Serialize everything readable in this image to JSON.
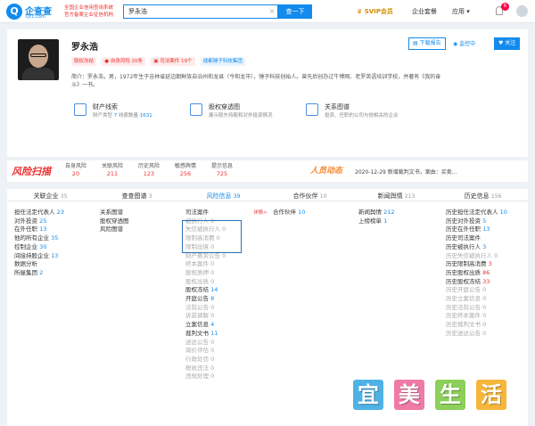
{
  "header": {
    "logo_glyph": "Q",
    "logo_name": "企查查",
    "logo_sub": "Qcc.com",
    "slogan_line1": "全国企业信用查询系统",
    "slogan_line2": "官方备案企业征信机构",
    "search_value": "罗永浩",
    "search_clear": "×",
    "search_button": "查一下",
    "svip": "SVIP会员",
    "nav_enterprise": "企业套餐",
    "nav_apps": "应用",
    "badge_count": "6",
    "brand_color": "#128bed"
  },
  "person": {
    "name": "罗永浩",
    "tags": [
      "股权冻结",
      "自身风险 20条",
      "司法案件 19个",
      "成都锤子科技集团"
    ],
    "bio": "简介：罗永浩，男，1972年生于吉林省延边朝鲜族自治州和龙县（今和龙市），锤子科技创始人。曾先后创办过牛博网、老罗英语培训学校，并著有《我的奋斗》一书。",
    "report_button": "下载报告",
    "monitor_button": "监控中",
    "follow_button": "关注"
  },
  "features": [
    {
      "title": "财产线索",
      "desc_prefix": "财产类型 ",
      "desc_a": "7",
      "desc_mid": " 线索数量 ",
      "desc_b": "1631"
    },
    {
      "title": "股权穿透图",
      "desc": "展示股东持股和对外投资情况"
    },
    {
      "title": "关系图谱",
      "desc": "投资、任职的公司与他相关的企业"
    }
  ],
  "risk": {
    "logo": "风险扫描",
    "cols": [
      {
        "label": "自身风险",
        "value": "20"
      },
      {
        "label": "关联风险",
        "value": "211"
      },
      {
        "label": "历史风险",
        "value": "123"
      },
      {
        "label": "敏感舆情",
        "value": "256"
      },
      {
        "label": "提示信息",
        "value": "725"
      }
    ],
    "news_logo": "人员动态",
    "news_text": "2020-12-29 新增裁判文书，案由：买卖..."
  },
  "tabs": [
    {
      "label": "关联企业",
      "count": "35"
    },
    {
      "label": "查查图谱",
      "count": "3"
    },
    {
      "label": "风险信息",
      "count": "39"
    },
    {
      "label": "合作伙伴",
      "count": "10"
    },
    {
      "label": "新闻舆情",
      "count": "213"
    },
    {
      "label": "历史信息",
      "count": "156"
    }
  ],
  "list": {
    "detail_link": "详情>",
    "col1": [
      {
        "t": "担任法定代表人",
        "n": "23"
      },
      {
        "t": "对外投资",
        "n": "25"
      },
      {
        "t": "在外任职",
        "n": "13"
      },
      {
        "t": "他的所有企业",
        "n": "35"
      },
      {
        "t": "控制企业",
        "n": "30"
      },
      {
        "t": "间接持股企业",
        "n": "13"
      },
      {
        "t": "数据分析",
        "n": ""
      },
      {
        "t": "所屋集团",
        "n": "2"
      }
    ],
    "col2": [
      {
        "t": "关系图谱"
      },
      {
        "t": "股权穿透图"
      },
      {
        "t": "风险图谱"
      }
    ],
    "col3": [
      {
        "t": "司法案件",
        "n": "",
        "g": false
      },
      {
        "t": "被执行人",
        "n": "0",
        "g": true
      },
      {
        "t": "失信被执行人",
        "n": "0",
        "g": true
      },
      {
        "t": "限制高消费",
        "n": "0",
        "g": true
      },
      {
        "t": "限制出境",
        "n": "0",
        "g": true
      },
      {
        "t": "财产悬赏公告",
        "n": "0",
        "g": true
      },
      {
        "t": "终本案件",
        "n": "0",
        "g": true
      },
      {
        "t": "股权质押",
        "n": "0",
        "g": true
      },
      {
        "t": "股权出质",
        "n": "0",
        "g": true
      },
      {
        "t": "股权冻结",
        "n": "14",
        "g": false
      },
      {
        "t": "开庭公告",
        "n": "8",
        "g": false
      },
      {
        "t": "法院公告",
        "n": "0",
        "g": true
      },
      {
        "t": "诉前调解",
        "n": "0",
        "g": true
      },
      {
        "t": "立案信息",
        "n": "4",
        "g": false
      },
      {
        "t": "裁判文书",
        "n": "11",
        "g": false
      },
      {
        "t": "送达公告",
        "n": "0",
        "g": true
      },
      {
        "t": "询价评估",
        "n": "0",
        "g": true
      },
      {
        "t": "行政处罚",
        "n": "0",
        "g": true
      },
      {
        "t": "税收违法",
        "n": "0",
        "g": true
      },
      {
        "t": "违规处理",
        "n": "0",
        "g": true
      }
    ],
    "col4": [
      {
        "t": "合作伙伴",
        "n": "10"
      }
    ],
    "col5": [
      {
        "t": "新闻舆情",
        "n": "212"
      },
      {
        "t": "上榜榜单",
        "n": "1"
      }
    ],
    "col6": [
      {
        "t": "历史担任法定代表人",
        "n": "10",
        "g": false,
        "r": false
      },
      {
        "t": "历史对外投资",
        "n": "5",
        "g": false,
        "r": false
      },
      {
        "t": "历史在外任职",
        "n": "13",
        "g": false,
        "r": false
      },
      {
        "t": "历史司法案件",
        "n": "",
        "g": false,
        "r": false
      },
      {
        "t": "历史被执行人",
        "n": "3",
        "g": false,
        "r": false
      },
      {
        "t": "历史失信被执行人",
        "n": "0",
        "g": true,
        "r": false
      },
      {
        "t": "历史限制高消费",
        "n": "3",
        "g": false,
        "r": true
      },
      {
        "t": "历史股权出质",
        "n": "86",
        "g": false,
        "r": true
      },
      {
        "t": "历史股权冻结",
        "n": "33",
        "g": false,
        "r": true
      },
      {
        "t": "历史开庭公告",
        "n": "0",
        "g": true,
        "r": false
      },
      {
        "t": "历史立案信息",
        "n": "0",
        "g": true,
        "r": false
      },
      {
        "t": "历史法院公告",
        "n": "0",
        "g": true,
        "r": false
      },
      {
        "t": "历史终本案件",
        "n": "0",
        "g": true,
        "r": false
      },
      {
        "t": "历史裁判文书",
        "n": "0",
        "g": true,
        "r": false
      },
      {
        "t": "历史送达公告",
        "n": "0",
        "g": true,
        "r": false
      }
    ]
  },
  "watermark": [
    "宜",
    "美",
    "生",
    "活"
  ],
  "watermark_colors": [
    "#4fb2e6",
    "#f07aa6",
    "#8ccf5a",
    "#f6b63c"
  ]
}
